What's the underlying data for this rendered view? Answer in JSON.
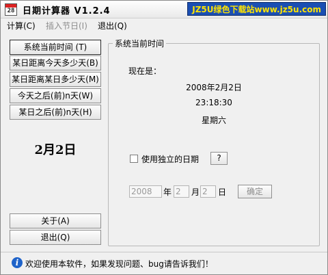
{
  "titlebar": {
    "title": "日期计算器  V1.2.4",
    "watermark": "JZ5U绿色下载站www.jz5u.com",
    "icon_day": "28"
  },
  "menu": {
    "items": [
      {
        "label": "计算(C)",
        "enabled": true
      },
      {
        "label": "插入节日(I)",
        "enabled": false
      },
      {
        "label": "退出(Q)",
        "enabled": true
      }
    ]
  },
  "left_buttons": [
    {
      "label": "系统当前时间    (T)"
    },
    {
      "label": "某日距离今天多少天(B)"
    },
    {
      "label": "某日距离某日多少天(M)"
    },
    {
      "label": "今天之后(前)n天(W)"
    },
    {
      "label": "某日之后(前)n天(H)"
    }
  ],
  "big_date": "2月2日",
  "bottom_buttons": {
    "about": "关于(A)",
    "exit": "退出(Q)"
  },
  "panel": {
    "title": "系统当前时间",
    "now_label": "现在是：",
    "date": "2008年2月2日",
    "time": "23:18:30",
    "weekday": "星期六",
    "use_independent_date": {
      "label": "使用独立的日期",
      "checked": false,
      "help_label": "?"
    },
    "date_fields": {
      "year": "2008",
      "year_unit": "年",
      "month": "2",
      "month_unit": "月",
      "day": "2",
      "day_unit": "日",
      "confirm_label": "确定"
    }
  },
  "statusbar": {
    "text": "欢迎使用本软件，如果发现问题、bug请告诉我们！"
  },
  "colors": {
    "watermark_bg": "#1b4fb3",
    "watermark_fg": "#ffe300",
    "info_icon": "#1f63c9",
    "disabled_text": "#8c8c8c"
  }
}
